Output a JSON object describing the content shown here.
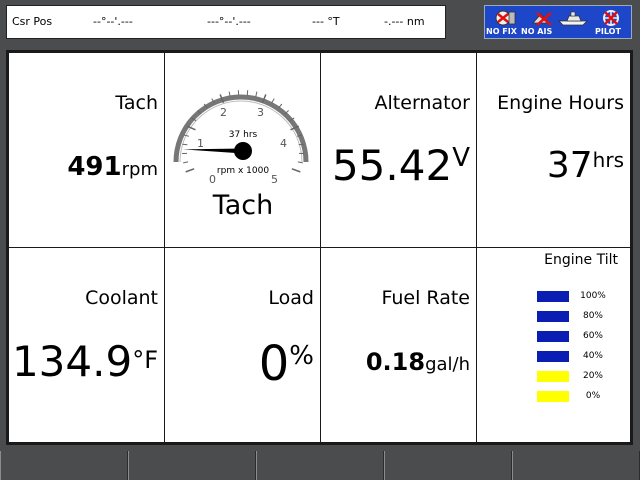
{
  "topbar": {
    "csr_label": "Csr Pos",
    "lat": "--°--'.---",
    "lon": "---°--'.---",
    "bearing": "--- °T",
    "range": "-.--- nm"
  },
  "status": {
    "nofix": "NO FIX",
    "noais": "NO AIS",
    "pilot": "PILOT"
  },
  "cells": {
    "tach": {
      "label": "Tach",
      "value": "491",
      "unit": "rpm"
    },
    "gauge": {
      "title": "Tach",
      "hours": "37 hrs",
      "units": "rpm x 1000",
      "ticks": [
        "0",
        "1",
        "2",
        "3",
        "4",
        "5"
      ],
      "value_krpm": 0.491
    },
    "alternator": {
      "label": "Alternator",
      "value": "55.42",
      "unit": "V"
    },
    "engine_hours": {
      "label": "Engine Hours",
      "value": "37",
      "unit": "hrs"
    },
    "coolant": {
      "label": "Coolant",
      "value": "134.9",
      "unit": "°F"
    },
    "load": {
      "label": "Load",
      "value": "0",
      "unit": "%"
    },
    "fuel_rate": {
      "label": "Fuel Rate",
      "value": "0.18",
      "unit": "gal/h"
    },
    "engine_tilt": {
      "label": "Engine Tilt",
      "levels": [
        {
          "text": "100%",
          "color": "#0a1eb4"
        },
        {
          "text": "80%",
          "color": "#0a1eb4"
        },
        {
          "text": "60%",
          "color": "#0a1eb4"
        },
        {
          "text": "40%",
          "color": "#0a1eb4"
        },
        {
          "text": "20%",
          "color": "#ffff00"
        },
        {
          "text": "0%",
          "color": "#ffff00"
        }
      ]
    }
  },
  "colors": {
    "accent": "#1e46c8",
    "background": "#4a4c4e",
    "panel": "#ffffff"
  }
}
